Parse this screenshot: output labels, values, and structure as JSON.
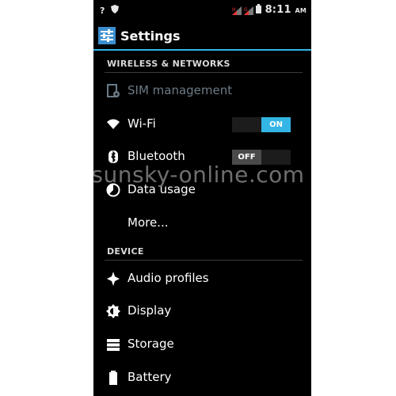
{
  "status_bar": {
    "left_icons": [
      "question-icon",
      "shield-icon"
    ],
    "right_icons": [
      "signal-1-icon",
      "signal-2-icon",
      "battery-icon"
    ],
    "time": "8:11",
    "ampm": "AM"
  },
  "action_bar": {
    "icon": "settings-app-icon",
    "title": "Settings"
  },
  "sections": {
    "wireless": {
      "header": "WIRELESS & NETWORKS"
    },
    "device": {
      "header": "DEVICE"
    }
  },
  "items": {
    "sim": {
      "label": "SIM management",
      "icon": "sim-icon",
      "enabled": false
    },
    "wifi": {
      "label": "Wi-Fi",
      "icon": "wifi-icon",
      "toggle": "ON"
    },
    "bluetooth": {
      "label": "Bluetooth",
      "icon": "bluetooth-icon",
      "toggle": "OFF"
    },
    "data_usage": {
      "label": "Data usage",
      "icon": "data-usage-icon"
    },
    "more": {
      "label": "More..."
    },
    "audio": {
      "label": "Audio profiles",
      "icon": "audio-profiles-icon"
    },
    "display": {
      "label": "Display",
      "icon": "display-icon"
    },
    "storage": {
      "label": "Storage",
      "icon": "storage-icon"
    },
    "battery": {
      "label": "Battery",
      "icon": "battery-settings-icon"
    }
  },
  "watermark": "sunsky-online.com",
  "colors": {
    "accent": "#33b5e5",
    "background": "#000000",
    "disabled_text": "#6b7b86"
  }
}
